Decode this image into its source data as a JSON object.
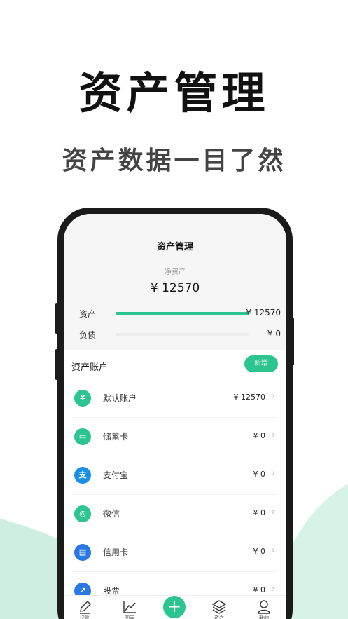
{
  "hero": {
    "title": "资产管理",
    "subtitle": "资产数据一目了然"
  },
  "colors": {
    "accent": "#2cc48f",
    "wave": "#cdeee1"
  },
  "app": {
    "title": "资产管理",
    "net_label": "净资产",
    "net_value": "¥ 12570",
    "bars": [
      {
        "label": "资产",
        "value": "¥ 12570",
        "fill_fraction": 1.0
      },
      {
        "label": "负债",
        "value": "¥ 0",
        "fill_fraction": 0.0
      }
    ],
    "section_title": "资产账户",
    "add_label": "新增",
    "accounts": [
      {
        "name": "默认账户",
        "amount": "¥ 12570",
        "icon": "money-bag-icon",
        "color": "#2cc48f",
        "glyph": "¥"
      },
      {
        "name": "储蓄卡",
        "amount": "¥ 0",
        "icon": "debit-card-icon",
        "color": "#2cc48f",
        "glyph": "▭"
      },
      {
        "name": "支付宝",
        "amount": "¥ 0",
        "icon": "alipay-icon",
        "color": "#1a8fe3",
        "glyph": "支"
      },
      {
        "name": "微信",
        "amount": "¥ 0",
        "icon": "wechat-icon",
        "color": "#2cc48f",
        "glyph": "◎"
      },
      {
        "name": "信用卡",
        "amount": "¥ 0",
        "icon": "credit-card-icon",
        "color": "#2a78e4",
        "glyph": "▤"
      },
      {
        "name": "股票",
        "amount": "¥ 0",
        "icon": "stock-icon",
        "color": "#2a78e4",
        "glyph": "↗"
      }
    ],
    "tabs": [
      {
        "label": "记账",
        "icon": "pencil-icon"
      },
      {
        "label": "图表",
        "icon": "chart-icon"
      },
      {
        "label": "",
        "icon": "plus-icon"
      },
      {
        "label": "资产",
        "icon": "layers-icon"
      },
      {
        "label": "我的",
        "icon": "user-icon"
      }
    ]
  }
}
